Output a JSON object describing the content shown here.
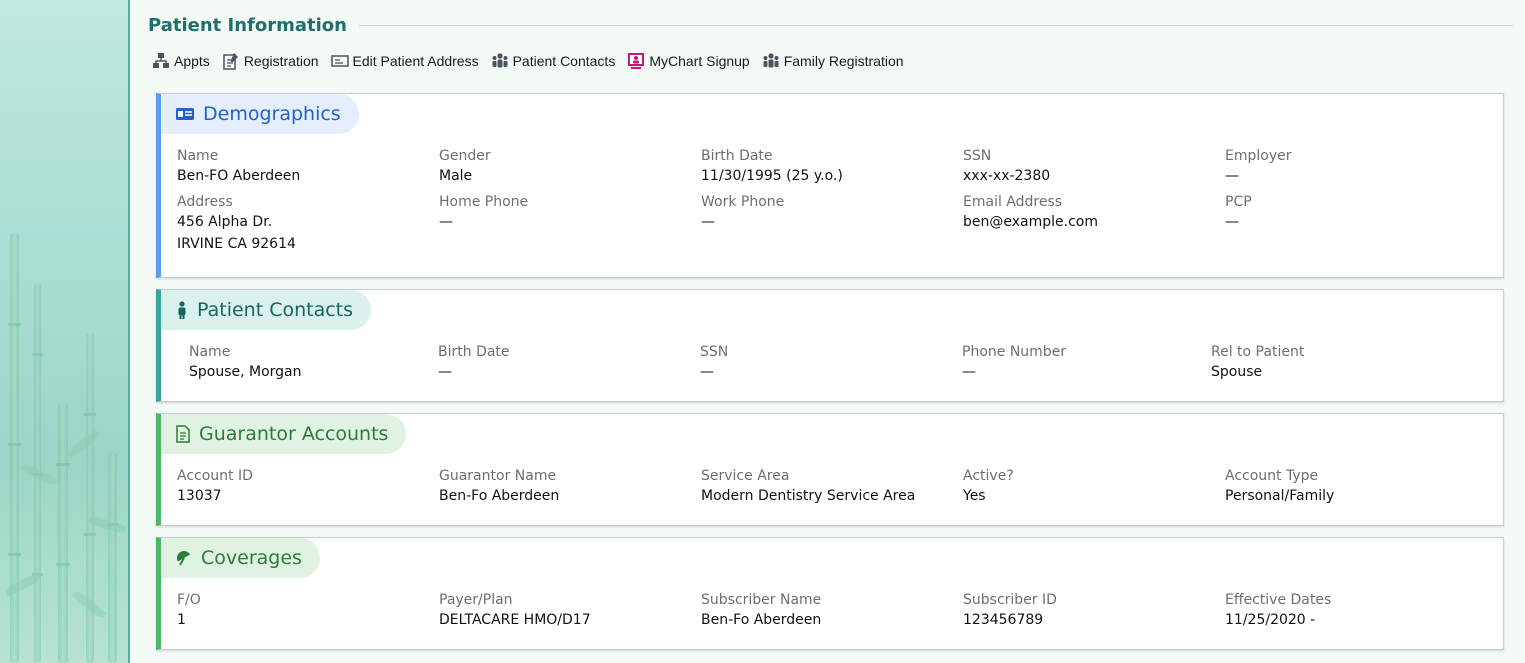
{
  "section": {
    "title": "Patient Information"
  },
  "toolbar": [
    {
      "label": "Appts",
      "icon": "network-icon"
    },
    {
      "label": "Registration",
      "icon": "edit-document-icon"
    },
    {
      "label": "Edit Patient Address",
      "icon": "address-card-icon"
    },
    {
      "label": "Patient Contacts",
      "icon": "people-icon"
    },
    {
      "label": "MyChart Signup",
      "icon": "mychart-icon"
    },
    {
      "label": "Family Registration",
      "icon": "family-icon"
    }
  ],
  "demographics": {
    "title": "Demographics",
    "fields": [
      {
        "label": "Name",
        "value": "Ben-FO Aberdeen"
      },
      {
        "label": "Gender",
        "value": "Male"
      },
      {
        "label": "Birth Date",
        "value": "11/30/1995 (25 y.o.)"
      },
      {
        "label": "SSN",
        "value": "xxx-xx-2380"
      },
      {
        "label": "Employer",
        "value": "—"
      },
      {
        "label": "Address",
        "value": "456 Alpha Dr.\nIRVINE CA 92614"
      },
      {
        "label": "Home Phone",
        "value": "—"
      },
      {
        "label": "Work Phone",
        "value": "—"
      },
      {
        "label": "Email Address",
        "value": "ben@example.com"
      },
      {
        "label": "PCP",
        "value": "—"
      }
    ]
  },
  "contacts": {
    "title": "Patient Contacts",
    "fields": [
      {
        "label": "Name",
        "value": "Spouse, Morgan"
      },
      {
        "label": "Birth Date",
        "value": "—"
      },
      {
        "label": "SSN",
        "value": "—"
      },
      {
        "label": "Phone Number",
        "value": "—"
      },
      {
        "label": "Rel to Patient",
        "value": "Spouse"
      }
    ]
  },
  "guarantor": {
    "title": "Guarantor Accounts",
    "fields": [
      {
        "label": "Account ID",
        "value": "13037"
      },
      {
        "label": "Guarantor Name",
        "value": "Ben-Fo Aberdeen"
      },
      {
        "label": "Service Area",
        "value": "Modern Dentistry Service Area"
      },
      {
        "label": "Active?",
        "value": "Yes"
      },
      {
        "label": "Account Type",
        "value": "Personal/Family"
      }
    ]
  },
  "coverages": {
    "title": "Coverages",
    "fields": [
      {
        "label": "F/O",
        "value": "1"
      },
      {
        "label": "Payer/Plan",
        "value": "DELTACARE HMO/D17"
      },
      {
        "label": "Subscriber Name",
        "value": "Ben-Fo Aberdeen"
      },
      {
        "label": "Subscriber ID",
        "value": "123456789"
      },
      {
        "label": "Effective Dates",
        "value": "11/25/2020 -"
      }
    ]
  },
  "colors": {
    "demographics_accent": "#5b9bf0",
    "contacts_accent": "#3aa597",
    "guarantor_accent": "#4fb56b",
    "coverages_accent": "#4fb56b"
  }
}
